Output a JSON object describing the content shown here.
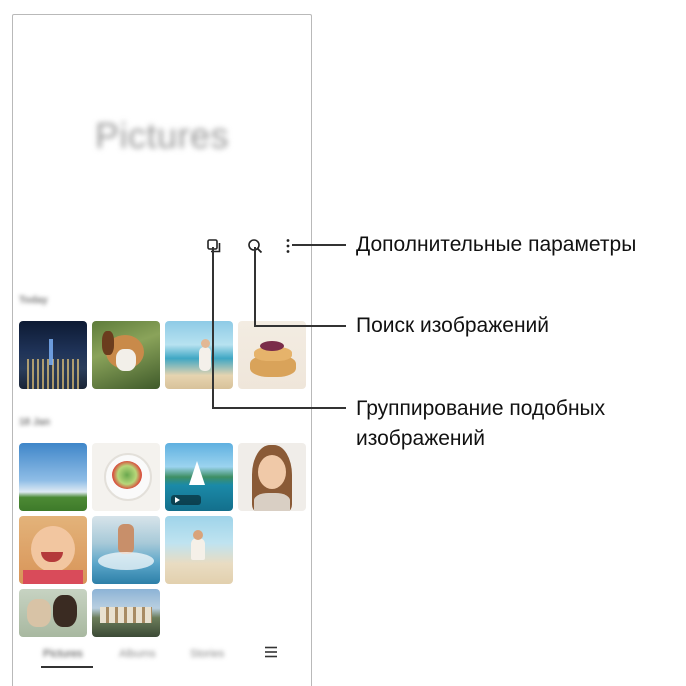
{
  "app": {
    "title": "Pictures"
  },
  "toolbar": {
    "icons": [
      "group-similar-icon",
      "search-icon",
      "more-options-icon"
    ]
  },
  "sections": [
    {
      "label": "Today"
    },
    {
      "label": "18 Jan"
    }
  ],
  "bottom_nav": {
    "tabs": [
      "Pictures",
      "Albums",
      "Stories"
    ],
    "active": "Pictures"
  },
  "callouts": {
    "more_options": "Дополнительные параметры",
    "search": "Поиск изображений",
    "group_similar_line1": "Группирование подобных",
    "group_similar_line2": "изображений"
  },
  "colors": {
    "callout_line": "#333333",
    "frame": "#b9b9b9"
  }
}
